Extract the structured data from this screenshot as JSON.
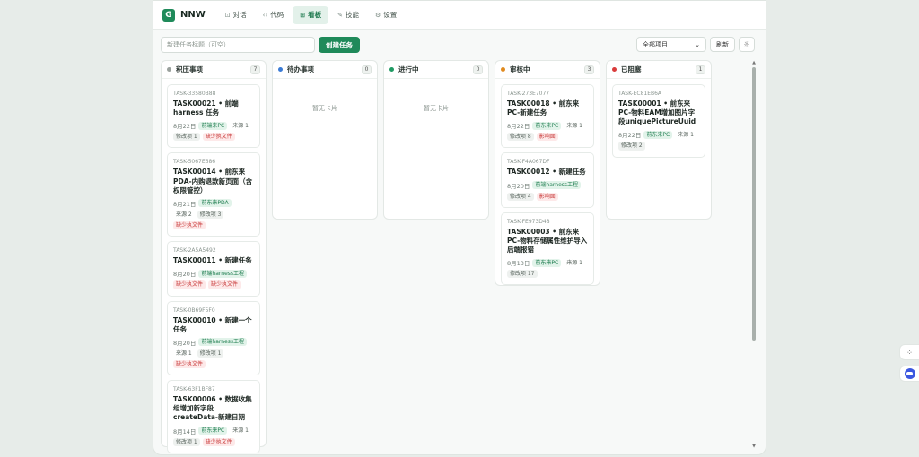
{
  "app": {
    "logo_letter": "G",
    "name": "NNW"
  },
  "nav": [
    {
      "icon": "⊡",
      "label": "对话"
    },
    {
      "icon": "‹›",
      "label": "代码"
    },
    {
      "icon": "⊞",
      "label": "看板"
    },
    {
      "icon": "✎",
      "label": "技能"
    },
    {
      "icon": "⚙",
      "label": "设置"
    }
  ],
  "toolbar": {
    "task_placeholder": "新建任务标题（可空）",
    "create_label": "创建任务",
    "filter_value": "全部项目",
    "refresh_label": "刷新",
    "theme_icon": "☼"
  },
  "columns": [
    {
      "title": "积压事项",
      "color": "#9aa19d",
      "count": "7",
      "cards": [
        {
          "id": "TASK-33580B88",
          "title": "TASK00021 • 前端harness 任务",
          "date": "8月22日",
          "tags": [
            {
              "text": "前端来PC",
              "style": "green"
            },
            {
              "text": "来源 1",
              "style": "plain"
            },
            {
              "text": "修改项 1",
              "style": "gray"
            },
            {
              "text": "缺少执文件",
              "style": "red"
            }
          ]
        },
        {
          "id": "TASK-5067E686",
          "title": "TASK00014 • 前东来PDA-内购退款新页面（含权限管控）",
          "date": "8月21日",
          "tags": [
            {
              "text": "前东来PDA",
              "style": "green"
            },
            {
              "text": "来源 2",
              "style": "plain"
            },
            {
              "text": "修改项 3",
              "style": "gray"
            },
            {
              "text": "缺少执文件",
              "style": "red"
            }
          ]
        },
        {
          "id": "TASK-2A5A5492",
          "title": "TASK00011 • 新建任务",
          "date": "8月20日",
          "tags": [
            {
              "text": "前端harness工程",
              "style": "green"
            },
            {
              "text": "缺少执文件",
              "style": "red"
            },
            {
              "text": "缺少执文件",
              "style": "red"
            }
          ]
        },
        {
          "id": "TASK-0B69F5F0",
          "title": "TASK00010 • 新建一个任务",
          "date": "8月20日",
          "tags": [
            {
              "text": "前端harness工程",
              "style": "green"
            },
            {
              "text": "来源 1",
              "style": "plain"
            },
            {
              "text": "修改项 1",
              "style": "gray"
            },
            {
              "text": "缺少执文件",
              "style": "red"
            }
          ]
        },
        {
          "id": "TASK-63F1BF87",
          "title": "TASK00006 • 数据收集组增加新字段createData-新建日期",
          "date": "8月14日",
          "tags": [
            {
              "text": "前东来PC",
              "style": "green"
            },
            {
              "text": "来源 1",
              "style": "plain"
            },
            {
              "text": "修改项 1",
              "style": "gray"
            },
            {
              "text": "缺少执文件",
              "style": "red"
            }
          ]
        }
      ]
    },
    {
      "title": "待办事项",
      "color": "#3a7bd5",
      "count": "0",
      "empty": "暂无卡片",
      "cards": []
    },
    {
      "title": "进行中",
      "color": "#1f9a63",
      "count": "0",
      "empty": "暂无卡片",
      "cards": []
    },
    {
      "title": "审核中",
      "color": "#e08a1e",
      "count": "3",
      "cards": [
        {
          "id": "TASK-273E7077",
          "title": "TASK00018 • 前东来PC-新建任务",
          "date": "8月22日",
          "tags": [
            {
              "text": "前东来PC",
              "style": "green"
            },
            {
              "text": "来源 1",
              "style": "plain"
            },
            {
              "text": "修改项 8",
              "style": "gray"
            },
            {
              "text": "影响面",
              "style": "red"
            }
          ]
        },
        {
          "id": "TASK-F4A067DF",
          "title": "TASK00012 • 新建任务",
          "date": "8月20日",
          "tags": [
            {
              "text": "前端harness工程",
              "style": "green"
            },
            {
              "text": "修改项 4",
              "style": "gray"
            },
            {
              "text": "影响面",
              "style": "red"
            }
          ]
        },
        {
          "id": "TASK-FE973D48",
          "title": "TASK00003 • 前东来PC-物料存储属性维护导入后端报错",
          "date": "8月13日",
          "tags": [
            {
              "text": "前东来PC",
              "style": "green"
            },
            {
              "text": "来源 1",
              "style": "plain"
            },
            {
              "text": "修改项 17",
              "style": "gray"
            }
          ]
        }
      ]
    },
    {
      "title": "已阻塞",
      "color": "#d93b3b",
      "count": "1",
      "cards": [
        {
          "id": "TASK-EC81EB6A",
          "title": "TASK00001 • 前东来PC-物料EAM增加图片字段uniquePictureUuid",
          "date": "8月22日",
          "tags": [
            {
              "text": "前东来PC",
              "style": "green"
            },
            {
              "text": "来源 1",
              "style": "plain"
            },
            {
              "text": "修改项 2",
              "style": "gray"
            }
          ]
        }
      ]
    }
  ]
}
